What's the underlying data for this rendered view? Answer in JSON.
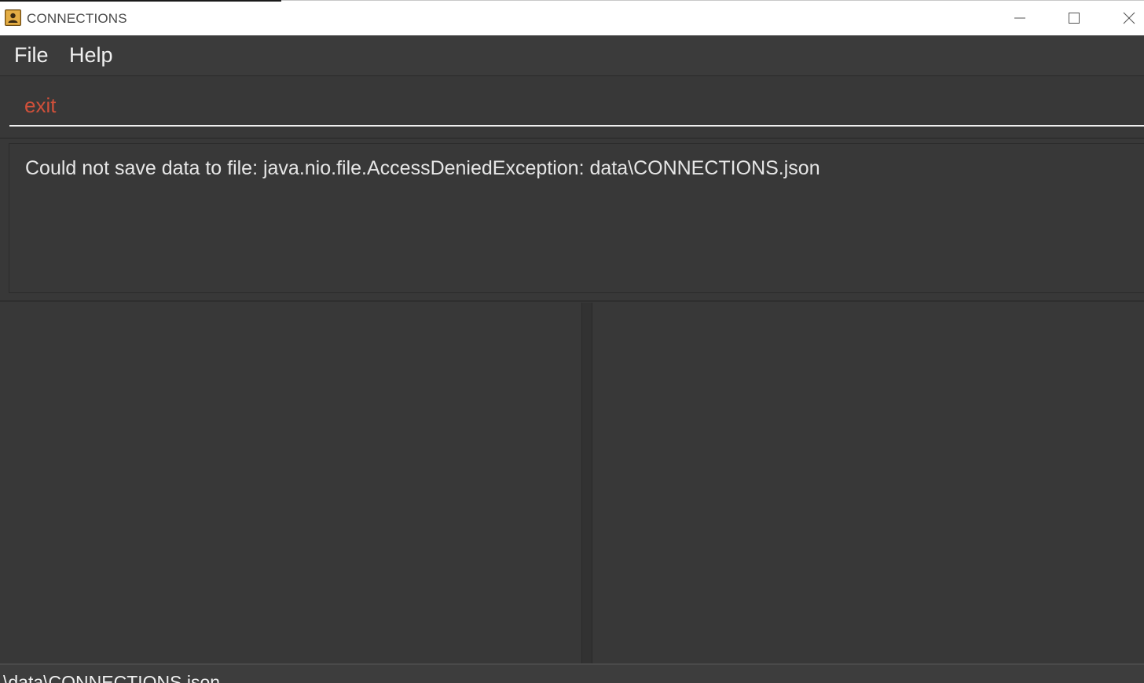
{
  "window": {
    "title": "CONNECTIONS",
    "icon": "address-book-icon",
    "controls": {
      "minimize": "minimize-icon",
      "maximize": "maximize-icon",
      "close": "close-icon"
    }
  },
  "menu": {
    "file_label": "File",
    "help_label": "Help"
  },
  "command_box": {
    "value": "exit",
    "text_color": "#d0503a"
  },
  "result_display": {
    "message": "Could not save data to file: java.nio.file.AccessDeniedException: data\\CONNECTIONS.json"
  },
  "status_bar": {
    "save_location": "\\data\\CONNECTIONS.json"
  },
  "colors": {
    "background": "#383838",
    "text": "#f0f0f0",
    "error_text": "#d0503a"
  }
}
